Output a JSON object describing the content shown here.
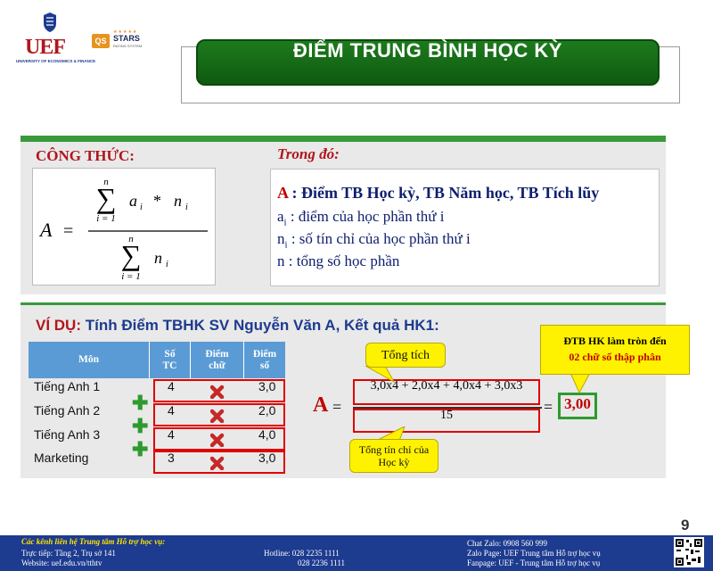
{
  "logos": {
    "uef_text": "UEF",
    "uef_sub": "UNIVERSITY OF ECONOMICS & FINANCE",
    "qs_box": "QS",
    "qs_stars": "STARS",
    "qs_rating": "RATING SYSTEM"
  },
  "title": "ĐIỂM TRUNG BÌNH HỌC KỲ",
  "formula": {
    "heading": "CÔNG THỨC:",
    "lhs": "A",
    "equals": "=",
    "sum_upper": "n",
    "sum_lower": "i = 1",
    "numer_a": "a",
    "numer_op": "*",
    "numer_n": "n",
    "sub_i": "i",
    "denom_n": "n"
  },
  "definitions": {
    "heading": "Trong đó:",
    "items": [
      {
        "sym": "A",
        "sub": "",
        "text": " : Điểm TB Học kỳ, TB Năm học, TB Tích lũy"
      },
      {
        "sym": "a",
        "sub": "i",
        "text": "  : điểm của học phần thứ i"
      },
      {
        "sym": "n",
        "sub": "i",
        "text": "  : số tín chỉ của học phần thứ i"
      },
      {
        "sym": "n",
        "sub": "",
        "text": "   : tổng số học phần"
      }
    ]
  },
  "example": {
    "label": "VÍ DỤ:",
    "desc": "Tính Điểm TBHK SV Nguyễn Văn A, Kết quả HK1:"
  },
  "table": {
    "headers": [
      "Môn",
      "Số TC",
      "Điểm chữ",
      "Điểm số"
    ],
    "rows": [
      {
        "subject": "Tiếng Anh 1",
        "tc": "4",
        "score": "3,0"
      },
      {
        "subject": "Tiếng Anh 2",
        "tc": "4",
        "score": "2,0"
      },
      {
        "subject": "Tiếng Anh 3",
        "tc": "4",
        "score": "4,0"
      },
      {
        "subject": "Marketing",
        "tc": "3",
        "score": "3,0"
      }
    ]
  },
  "calculation": {
    "lhs": "A",
    "equals": "=",
    "numerator": "3,0x4 + 2,0x4 + 4,0x4 + 3,0x3",
    "denominator": "15",
    "result": "3,00",
    "callout_top": "Tổng tích",
    "callout_bottom": "Tổng tín chỉ của Học kỳ",
    "note_line1": "ĐTB HK làm tròn đến",
    "note_line2": "02 chữ số thập phân"
  },
  "page_number": "9",
  "footer": {
    "title": "Các kênh liên hệ Trung tâm Hỗ trợ học vụ:",
    "direct": "Trực tiếp: Tầng 2, Trụ sở 141",
    "website": "Website:  uef.edu.vn/tthtv",
    "hotline1": "Hotline: 028 2235 1111",
    "hotline2": "028 2236 1111",
    "chat_zalo": "Chat Zalo: 0908 560 999",
    "zalo_page": "Zalo Page: UEF Trung tâm Hỗ trợ học vụ",
    "fanpage": "Fanpage:   UEF - Trung tâm Hỗ trợ học vụ"
  },
  "colors": {
    "title_green": "#1d7a1d",
    "accent_red": "#b0161c",
    "navy": "#1d3b8f",
    "table_header": "#5b9bd5",
    "callout_yellow": "#fff200"
  }
}
